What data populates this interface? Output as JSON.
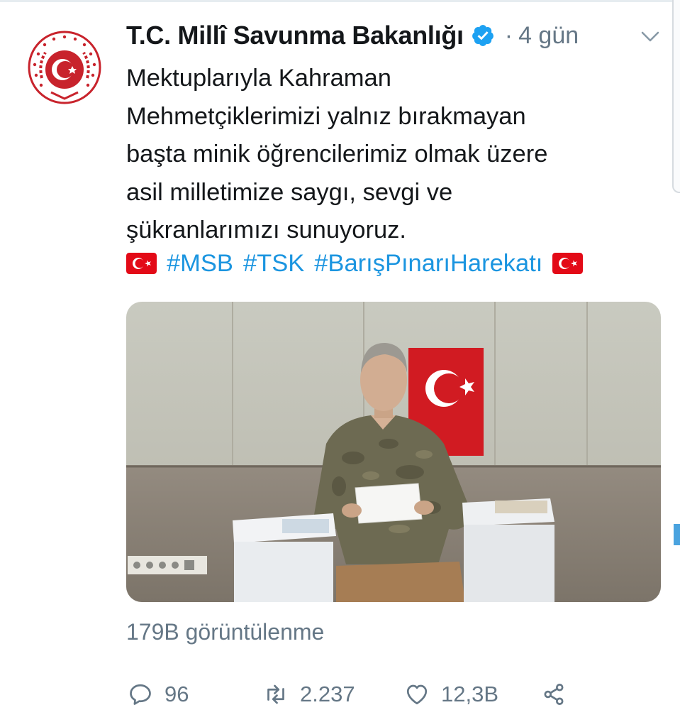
{
  "tweet": {
    "author_name": "T.C. Millî Savunma Bakanlığı",
    "separator": "·",
    "time": "4 gün",
    "text_lines": [
      "Mektuplarıyla Kahraman",
      "Mehmetçiklerimizi yalnız bırakmayan",
      "başta minik öğrencilerimiz olmak üzere",
      "asil milletimize saygı, sevgi ve",
      "şükranlarımızı sunuyoruz."
    ],
    "hashtags": [
      "#MSB",
      "#TSK",
      "#BarışPınarıHarekatı"
    ],
    "views": "179B görüntülenme"
  },
  "actions": {
    "reply_count": "96",
    "retweet_count": "2.237",
    "like_count": "12,3B"
  },
  "colors": {
    "link": "#1b95e0",
    "muted": "#657786",
    "verified": "#1da1f2",
    "flag_red": "#e30a17"
  },
  "icons": [
    "verified-badge-icon",
    "chevron-down-icon",
    "reply-icon",
    "retweet-icon",
    "like-icon",
    "share-icon",
    "turkish-flag-icon"
  ]
}
